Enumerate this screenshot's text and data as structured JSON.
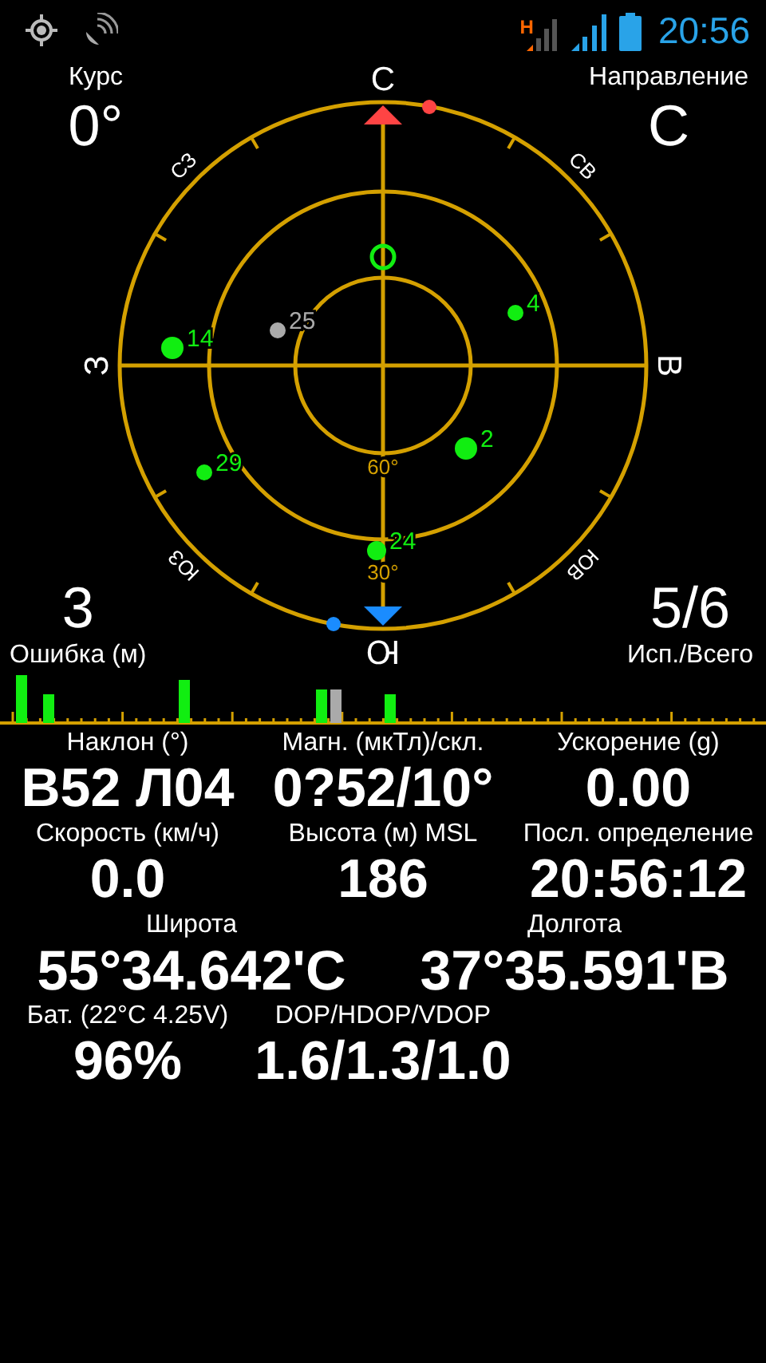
{
  "status_bar": {
    "network_type": "H",
    "time": "20:56"
  },
  "course": {
    "label": "Курс",
    "value": "0°"
  },
  "heading": {
    "label": "Направление",
    "value": "С"
  },
  "error": {
    "value": "3",
    "label": "Ошибка (м)"
  },
  "satellites_count": {
    "value": "5/6",
    "label": "Исп./Всего"
  },
  "compass": {
    "directions": [
      "С",
      "СВ",
      "В",
      "ЮВ",
      "Ю",
      "ЮЗ",
      "З",
      "СЗ"
    ],
    "rings": [
      "60°",
      "30°"
    ]
  },
  "satellites": [
    {
      "label": "25",
      "used": false
    },
    {
      "label": "14",
      "used": true
    },
    {
      "label": "4",
      "used": true
    },
    {
      "label": "2",
      "used": true
    },
    {
      "label": "29",
      "used": true
    },
    {
      "label": "24",
      "used": true
    }
  ],
  "rows": [
    {
      "kind": "triple",
      "cells": [
        {
          "label": "Наклон (°)",
          "value": "В52 Л04"
        },
        {
          "label": "Магн. (мкТл)/скл.",
          "value": "0?52/10°"
        },
        {
          "label": "Ускорение (g)",
          "value": "0.00"
        }
      ]
    },
    {
      "kind": "triple",
      "cells": [
        {
          "label": "Скорость (км/ч)",
          "value": "0.0"
        },
        {
          "label": "Высота (м) MSL",
          "value": "186"
        },
        {
          "label": "Посл. определение",
          "value": "20:56:12"
        }
      ]
    },
    {
      "kind": "wide",
      "cells": [
        {
          "label": "Широта",
          "value": "55°34.642'С"
        },
        {
          "label": "Долгота",
          "value": "37°35.591'В"
        }
      ]
    },
    {
      "kind": "triple",
      "cells": [
        {
          "label": "Бат. (22°C 4.25V)",
          "value": "96%"
        },
        {
          "label": "DOP/HDOP/VDOP",
          "value": "1.6/1.3/1.0"
        }
      ]
    }
  ]
}
